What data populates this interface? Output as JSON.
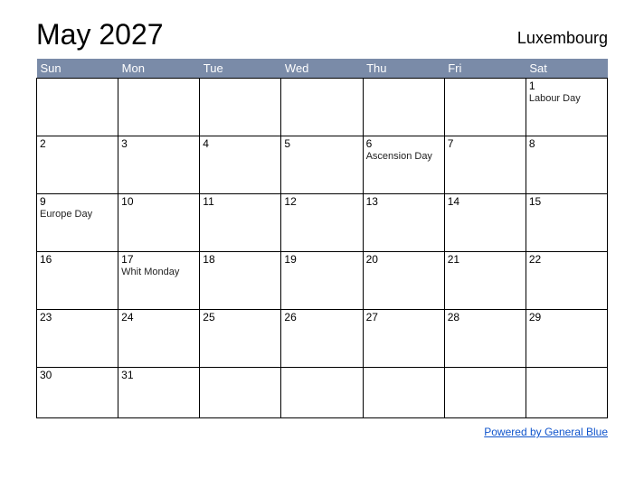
{
  "title": "May 2027",
  "country": "Luxembourg",
  "day_headers": [
    "Sun",
    "Mon",
    "Tue",
    "Wed",
    "Thu",
    "Fri",
    "Sat"
  ],
  "weeks": [
    [
      {
        "num": "",
        "event": ""
      },
      {
        "num": "",
        "event": ""
      },
      {
        "num": "",
        "event": ""
      },
      {
        "num": "",
        "event": ""
      },
      {
        "num": "",
        "event": ""
      },
      {
        "num": "",
        "event": ""
      },
      {
        "num": "1",
        "event": "Labour Day"
      }
    ],
    [
      {
        "num": "2",
        "event": ""
      },
      {
        "num": "3",
        "event": ""
      },
      {
        "num": "4",
        "event": ""
      },
      {
        "num": "5",
        "event": ""
      },
      {
        "num": "6",
        "event": "Ascension Day"
      },
      {
        "num": "7",
        "event": ""
      },
      {
        "num": "8",
        "event": ""
      }
    ],
    [
      {
        "num": "9",
        "event": "Europe Day"
      },
      {
        "num": "10",
        "event": ""
      },
      {
        "num": "11",
        "event": ""
      },
      {
        "num": "12",
        "event": ""
      },
      {
        "num": "13",
        "event": ""
      },
      {
        "num": "14",
        "event": ""
      },
      {
        "num": "15",
        "event": ""
      }
    ],
    [
      {
        "num": "16",
        "event": ""
      },
      {
        "num": "17",
        "event": "Whit Monday"
      },
      {
        "num": "18",
        "event": ""
      },
      {
        "num": "19",
        "event": ""
      },
      {
        "num": "20",
        "event": ""
      },
      {
        "num": "21",
        "event": ""
      },
      {
        "num": "22",
        "event": ""
      }
    ],
    [
      {
        "num": "23",
        "event": ""
      },
      {
        "num": "24",
        "event": ""
      },
      {
        "num": "25",
        "event": ""
      },
      {
        "num": "26",
        "event": ""
      },
      {
        "num": "27",
        "event": ""
      },
      {
        "num": "28",
        "event": ""
      },
      {
        "num": "29",
        "event": ""
      }
    ],
    [
      {
        "num": "30",
        "event": ""
      },
      {
        "num": "31",
        "event": ""
      },
      {
        "num": "",
        "event": ""
      },
      {
        "num": "",
        "event": ""
      },
      {
        "num": "",
        "event": ""
      },
      {
        "num": "",
        "event": ""
      },
      {
        "num": "",
        "event": ""
      }
    ]
  ],
  "footer_text": "Powered by General Blue"
}
